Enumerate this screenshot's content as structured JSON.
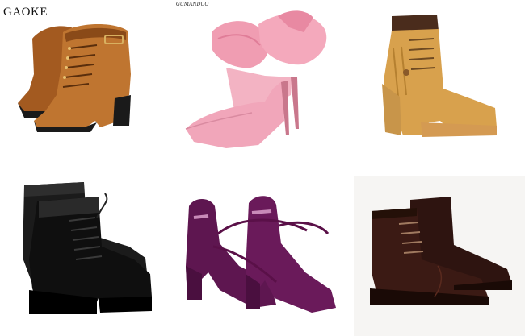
{
  "brands": {
    "top_left": "GAOKE",
    "top_middle": "GUMANDUO"
  },
  "products": [
    {
      "icon": "tan-lace-up-ankle-boot-icon",
      "color": "#b86b2a"
    },
    {
      "icon": "pink-bow-stiletto-pump-icon",
      "color": "#f0a5b8"
    },
    {
      "icon": "wheat-heeled-work-boot-icon",
      "color": "#d9a552"
    },
    {
      "icon": "black-chunky-lace-up-boot-icon",
      "color": "#111111"
    },
    {
      "icon": "purple-lace-up-block-heel-icon",
      "color": "#5e1650"
    },
    {
      "icon": "brown-leather-cap-toe-boot-icon",
      "color": "#3b1a14"
    }
  ]
}
